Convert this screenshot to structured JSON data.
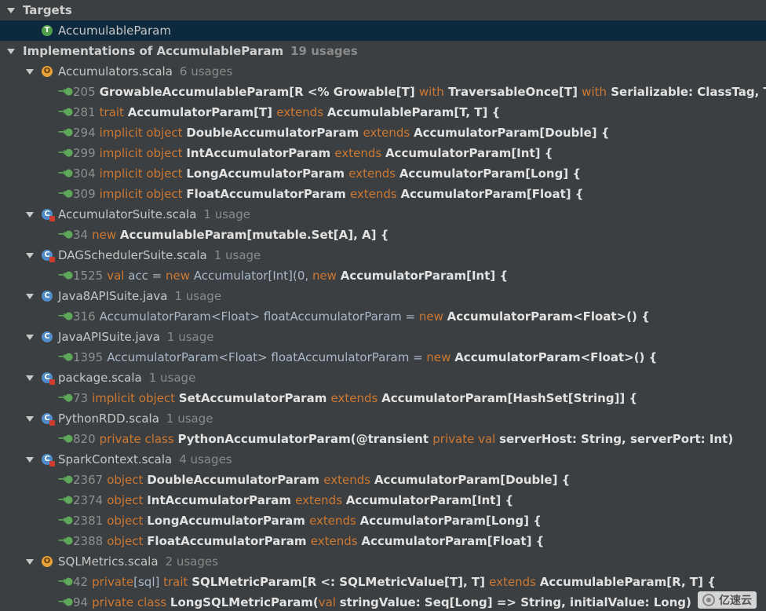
{
  "targets": {
    "label": "Targets",
    "item": {
      "label": "AccumulableParam",
      "icon": "trait-t-icon"
    }
  },
  "implementations": {
    "label": "Implementations of AccumulableParam",
    "count": "19 usages"
  },
  "files": [
    {
      "name": "Accumulators.scala",
      "count": "6 usages",
      "icon": "object-o-icon",
      "usages": [
        {
          "line": "205",
          "tokens": [
            [
              "b",
              "GrowableAccumulableParam[R <% Growable[T] "
            ],
            [
              "k",
              "with"
            ],
            [
              "b",
              " TraversableOnce[T] "
            ],
            [
              "k",
              "with"
            ],
            [
              "b",
              " Serializable: ClassTag, T]"
            ]
          ]
        },
        {
          "line": "281",
          "tokens": [
            [
              "k",
              "trait "
            ],
            [
              "b",
              "AccumulatorParam[T] "
            ],
            [
              "k",
              "extends "
            ],
            [
              "b",
              "AccumulableParam[T, T] {"
            ]
          ]
        },
        {
          "line": "294",
          "tokens": [
            [
              "k",
              "implicit object "
            ],
            [
              "b",
              "DoubleAccumulatorParam "
            ],
            [
              "k",
              "extends "
            ],
            [
              "b",
              "AccumulatorParam[Double] {"
            ]
          ]
        },
        {
          "line": "299",
          "tokens": [
            [
              "k",
              "implicit object "
            ],
            [
              "b",
              "IntAccumulatorParam "
            ],
            [
              "k",
              "extends "
            ],
            [
              "b",
              "AccumulatorParam[Int] {"
            ]
          ]
        },
        {
          "line": "304",
          "tokens": [
            [
              "k",
              "implicit object "
            ],
            [
              "b",
              "LongAccumulatorParam "
            ],
            [
              "k",
              "extends "
            ],
            [
              "b",
              "AccumulatorParam[Long] {"
            ]
          ]
        },
        {
          "line": "309",
          "tokens": [
            [
              "k",
              "implicit object "
            ],
            [
              "b",
              "FloatAccumulatorParam "
            ],
            [
              "k",
              "extends "
            ],
            [
              "b",
              "AccumulatorParam[Float] {"
            ]
          ]
        }
      ]
    },
    {
      "name": "AccumulatorSuite.scala",
      "count": "1 usage",
      "icon": "test-class-c-icon",
      "usages": [
        {
          "line": "34",
          "tokens": [
            [
              "k",
              "new "
            ],
            [
              "b",
              "AccumulableParam[mutable.Set[A], A] {"
            ]
          ]
        }
      ]
    },
    {
      "name": "DAGSchedulerSuite.scala",
      "count": "1 usage",
      "icon": "test-class-c-icon",
      "usages": [
        {
          "line": "1525",
          "tokens": [
            [
              "k",
              "val "
            ],
            [
              "n",
              "acc = "
            ],
            [
              "k",
              "new "
            ],
            [
              "n",
              "Accumulator[Int](0, "
            ],
            [
              "k",
              "new "
            ],
            [
              "b",
              "AccumulatorParam[Int] {"
            ]
          ]
        }
      ]
    },
    {
      "name": "Java8APISuite.java",
      "count": "1 usage",
      "icon": "java-class-c-icon",
      "usages": [
        {
          "line": "316",
          "tokens": [
            [
              "n",
              "AccumulatorParam<Float> floatAccumulatorParam = "
            ],
            [
              "k",
              "new "
            ],
            [
              "b",
              "AccumulatorParam<Float>() {"
            ]
          ]
        }
      ]
    },
    {
      "name": "JavaAPISuite.java",
      "count": "1 usage",
      "icon": "java-class-c-icon",
      "usages": [
        {
          "line": "1395",
          "tokens": [
            [
              "n",
              "AccumulatorParam<Float> floatAccumulatorParam = "
            ],
            [
              "k",
              "new "
            ],
            [
              "b",
              "AccumulatorParam<Float>() {"
            ]
          ]
        }
      ]
    },
    {
      "name": "package.scala",
      "count": "1 usage",
      "icon": "package-object-icon",
      "usages": [
        {
          "line": "73",
          "tokens": [
            [
              "k",
              "implicit object "
            ],
            [
              "b",
              "SetAccumulatorParam "
            ],
            [
              "k",
              "extends "
            ],
            [
              "b",
              "AccumulatorParam[HashSet[String]] {"
            ]
          ]
        }
      ]
    },
    {
      "name": "PythonRDD.scala",
      "count": "1 usage",
      "icon": "test-class-c-icon",
      "usages": [
        {
          "line": "820",
          "tokens": [
            [
              "k",
              "private class "
            ],
            [
              "b",
              "PythonAccumulatorParam(@transient "
            ],
            [
              "k",
              "private val "
            ],
            [
              "b",
              "serverHost: String, serverPort: Int)"
            ]
          ]
        }
      ]
    },
    {
      "name": "SparkContext.scala",
      "count": "4 usages",
      "icon": "test-class-c-icon",
      "usages": [
        {
          "line": "2367",
          "tokens": [
            [
              "k",
              "object "
            ],
            [
              "b",
              "DoubleAccumulatorParam "
            ],
            [
              "k",
              "extends "
            ],
            [
              "b",
              "AccumulatorParam[Double] {"
            ]
          ]
        },
        {
          "line": "2374",
          "tokens": [
            [
              "k",
              "object "
            ],
            [
              "b",
              "IntAccumulatorParam "
            ],
            [
              "k",
              "extends "
            ],
            [
              "b",
              "AccumulatorParam[Int] {"
            ]
          ]
        },
        {
          "line": "2381",
          "tokens": [
            [
              "k",
              "object "
            ],
            [
              "b",
              "LongAccumulatorParam "
            ],
            [
              "k",
              "extends "
            ],
            [
              "b",
              "AccumulatorParam[Long] {"
            ]
          ]
        },
        {
          "line": "2388",
          "tokens": [
            [
              "k",
              "object "
            ],
            [
              "b",
              "FloatAccumulatorParam "
            ],
            [
              "k",
              "extends "
            ],
            [
              "b",
              "AccumulatorParam[Float] {"
            ]
          ]
        }
      ]
    },
    {
      "name": "SQLMetrics.scala",
      "count": "2 usages",
      "icon": "object-o-icon",
      "usages": [
        {
          "line": "42",
          "tokens": [
            [
              "k",
              "private"
            ],
            [
              "n",
              "[sql] "
            ],
            [
              "k",
              "trait "
            ],
            [
              "b",
              "SQLMetricParam[R <: SQLMetricValue[T], T] "
            ],
            [
              "k",
              "extends "
            ],
            [
              "b",
              "AccumulableParam[R, T] {"
            ]
          ]
        },
        {
          "line": "94",
          "tokens": [
            [
              "k",
              "private class "
            ],
            [
              "b",
              "LongSQLMetricParam("
            ],
            [
              "k",
              "val "
            ],
            [
              "b",
              "stringValue: Seq[Long] => String, initialValue: Long)"
            ]
          ]
        }
      ]
    }
  ],
  "watermark": {
    "text": "亿速云",
    "icon": "cloud-logo-icon"
  },
  "colors": {
    "background": "#3c3f41",
    "selected": "#0d293e",
    "keyword": "#cc7832",
    "arrow": "#5fa85a"
  }
}
